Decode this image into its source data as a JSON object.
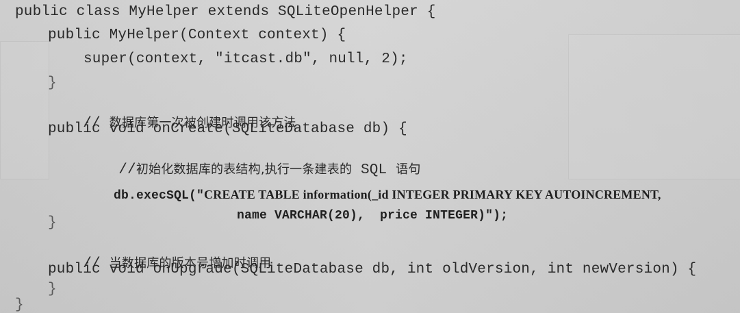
{
  "code": {
    "line1": "public class MyHelper extends SQLiteOpenHelper {",
    "line2": "public MyHelper(Context context) {",
    "line3": "super(context, \"itcast.db\", null, 2);",
    "line4": "}",
    "line5_prefix": "// ",
    "line5_comment": "数据库第一次被创建时调用该方法",
    "line6": "public void onCreate(SQLiteDatabase db) {",
    "line7_prefix": "//",
    "line7_comment_a": "初始化数据库的表结构,执行一条建表的",
    "line7_sql": " SQL ",
    "line7_comment_b": "语句",
    "line8_a": "db.execSQL(\"",
    "line8_b": "CREATE TABLE information(_id INTEGER PRIMARY KEY AUTOINCREMENT,",
    "line9_a": "name VARCHAR(20),  price INTEGER)\");",
    "line10": "}",
    "line11_prefix": "// ",
    "line11_comment": "当数据库的版本号增加时调用",
    "line12": "public void onUpgrade(SQLiteDatabase db, int oldVersion, int newVersion) {",
    "line13": "}",
    "line14": "}"
  }
}
